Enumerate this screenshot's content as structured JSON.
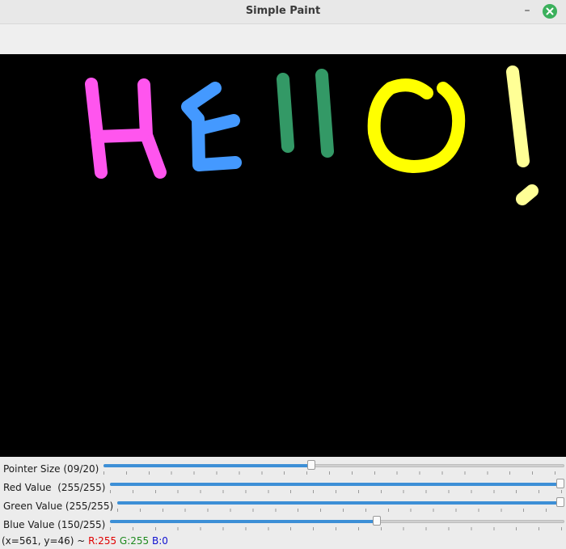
{
  "window": {
    "title": "Simple Paint",
    "minimize_glyph": "–"
  },
  "canvas": {
    "background": "#000000",
    "strokes": [
      {
        "label": "H",
        "color": "#ff55ee"
      },
      {
        "label": "E",
        "color": "#4499ff"
      },
      {
        "label": "l l",
        "color": "#339966"
      },
      {
        "label": "O",
        "color": "#ffff00"
      },
      {
        "label": "!",
        "color": "#ffff96"
      }
    ]
  },
  "controls": {
    "pointer_size": {
      "label": "Pointer Size (09/20)",
      "value": 9,
      "max": 20
    },
    "red": {
      "label": "Red Value  (255/255)",
      "value": 255,
      "max": 255
    },
    "green": {
      "label": "Green Value (255/255)",
      "value": 255,
      "max": 255
    },
    "blue": {
      "label": "Blue Value (150/255)",
      "value": 150,
      "max": 255
    }
  },
  "status": {
    "coords": "(x=561, y=46) ~ ",
    "r": "R:255",
    "g": "G:255",
    "b": "B:0"
  },
  "colors": {
    "accent": "#3d8fd6",
    "close_button": "#3bb05c"
  }
}
